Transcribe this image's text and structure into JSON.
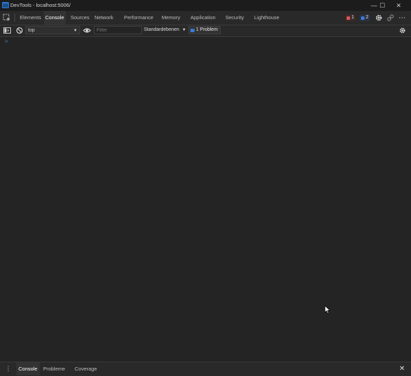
{
  "window": {
    "title": "DevTools - localhost:5006/",
    "minimize_glyph": "—",
    "maximize_glyph": "☐",
    "close_glyph": "✕"
  },
  "tabs": [
    {
      "label": "Elements",
      "active": false
    },
    {
      "label": "Console",
      "active": true
    },
    {
      "label": "Sources",
      "active": false
    },
    {
      "label": "Network",
      "active": false
    },
    {
      "label": "Performance",
      "active": false
    },
    {
      "label": "Memory",
      "active": false
    },
    {
      "label": "Application",
      "active": false
    },
    {
      "label": "Security",
      "active": false
    },
    {
      "label": "Lighthouse",
      "active": false
    }
  ],
  "badges": {
    "errors": "1",
    "warnings": "2",
    "error_color": "#e05454",
    "warning_color": "#3a7bd5"
  },
  "toolbar": {
    "context": "top",
    "filter_placeholder": "Filter",
    "levels_label": "Standardebenen",
    "issues_label": "1 Problem"
  },
  "console": {
    "prompt": ">"
  },
  "drawer": {
    "more_glyph": "⋮",
    "tabs": [
      {
        "label": "Console",
        "active": true
      },
      {
        "label": "Probleme",
        "active": false
      },
      {
        "label": "Coverage",
        "active": false
      }
    ],
    "close_glyph": "✕"
  },
  "icons": {
    "inspect": "inspect-element-icon",
    "device": "device-toolbar-icon",
    "sidebar": "show-sidebar-icon",
    "clear": "clear-console-icon",
    "eye": "live-expression-icon",
    "settings": "gear-icon",
    "more": "more-options-icon",
    "connect": "remote-devices-icon"
  },
  "colors": {
    "background": "#242424",
    "accent": "#3a7bd5"
  }
}
